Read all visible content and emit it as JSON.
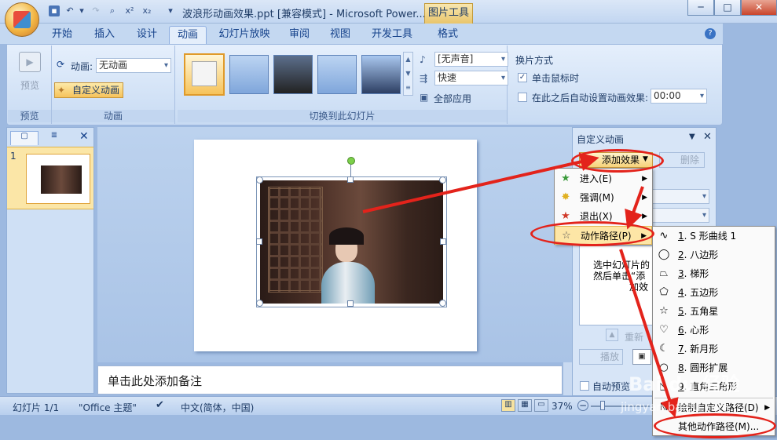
{
  "title_bar": {
    "document_title": "波浪形动画效果.ppt [兼容模式] - Microsoft Power...",
    "contextual_tab": "图片工具",
    "minimize": "─",
    "maximize": "□",
    "close": "✕"
  },
  "tabs": [
    "开始",
    "插入",
    "设计",
    "动画",
    "幻灯片放映",
    "审阅",
    "视图",
    "开发工具",
    "格式"
  ],
  "active_tab": "动画",
  "ribbon": {
    "preview_group": {
      "button": "预览",
      "label": "预览"
    },
    "animation_group": {
      "animation_label": "动画:",
      "animation_value": "无动画",
      "custom_animation": "自定义动画",
      "label": "动画"
    },
    "transition_group": {
      "label": "切换到此幻灯片",
      "sound_value": "[无声音]",
      "speed_value": "快速",
      "apply_all": "全部应用"
    },
    "advance_group": {
      "title": "换片方式",
      "on_click": "单击鼠标时",
      "on_click_checked": true,
      "auto_after": "在此之后自动设置动画效果:",
      "auto_after_checked": false,
      "time_value": "00:00"
    }
  },
  "slides_panel": {
    "slide_number": "1"
  },
  "notes_placeholder": "单击此处添加备注",
  "status_bar": {
    "slide_info": "幻灯片 1/1",
    "theme": "\"Office 主题\"",
    "language": "中文(简体，中国)",
    "zoom": "37%"
  },
  "task_pane": {
    "title": "自定义动画",
    "add_effect": "添加效果",
    "delete": "删除",
    "instructions_line1": "选中幻灯片的",
    "instructions_line2": "然后单击“添",
    "instructions_line3": "加效",
    "reorder": "重新",
    "play": "播放",
    "autopreview": "自动预览"
  },
  "effect_menu": [
    {
      "label": "进入(E)",
      "icon": "star-green-icon"
    },
    {
      "label": "强调(M)",
      "icon": "star-yellow-icon"
    },
    {
      "label": "退出(X)",
      "icon": "star-red-icon"
    },
    {
      "label": "动作路径(P)",
      "icon": "star-outline-icon"
    }
  ],
  "motion_paths_menu": [
    {
      "num": "1",
      "label": ". S 形曲线 1",
      "icon": "s-curve-icon"
    },
    {
      "num": "2",
      "label": ". 八边形",
      "icon": "octagon-icon"
    },
    {
      "num": "3",
      "label": ". 梯形",
      "icon": "trapezoid-icon"
    },
    {
      "num": "4",
      "label": ". 五边形",
      "icon": "pentagon-icon"
    },
    {
      "num": "5",
      "label": ". 五角星",
      "icon": "star-icon"
    },
    {
      "num": "6",
      "label": ". 心形",
      "icon": "heart-icon"
    },
    {
      "num": "7",
      "label": ". 新月形",
      "icon": "crescent-icon"
    },
    {
      "num": "8",
      "label": ". 圆形扩展",
      "icon": "circle-icon"
    },
    {
      "num": "9",
      "label": ". 直角三角形",
      "icon": "triangle-icon"
    },
    {
      "num": "",
      "label": "绘制自定义路径(D)",
      "icon": "draw-path-icon"
    },
    {
      "num": "",
      "label": "其他动作路径(M)...",
      "icon": ""
    }
  ],
  "watermark": {
    "line1": "Bai du 经验",
    "line2": "jingyan.baidu.com"
  },
  "colors": {
    "annotation_red": "#e3231b",
    "ribbon_blue": "#c8dbf3"
  }
}
